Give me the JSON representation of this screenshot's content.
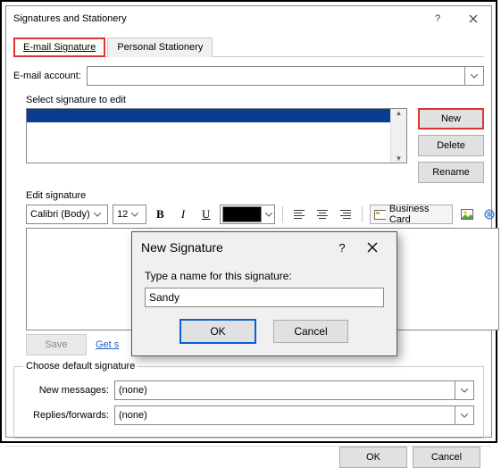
{
  "window": {
    "title": "Signatures and Stationery",
    "tabs": {
      "email": "E-mail Signature",
      "stationery": "Personal Stationery"
    },
    "email_account_label": "E-mail account:",
    "email_account_value": "",
    "select_sig_label": "Select signature to edit",
    "buttons": {
      "new": "New",
      "delete": "Delete",
      "rename": "Rename"
    },
    "edit_sig_label": "Edit signature",
    "toolbar": {
      "font": "Calibri (Body)",
      "size": "12",
      "business_card": "Business Card"
    },
    "save": "Save",
    "get_sig_link": "Get s",
    "defaults": {
      "legend": "Choose default signature",
      "new_msgs": "New messages:",
      "replies": "Replies/forwards:",
      "none": "(none)"
    },
    "footer": {
      "ok": "OK",
      "cancel": "Cancel"
    }
  },
  "modal": {
    "title": "New Signature",
    "prompt": "Type a name for this signature:",
    "value": "Sandy",
    "ok": "OK",
    "cancel": "Cancel"
  }
}
